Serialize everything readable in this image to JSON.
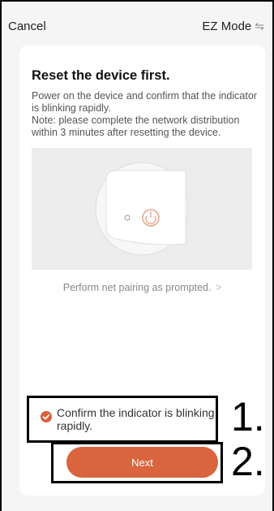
{
  "topbar": {
    "cancel_label": "Cancel",
    "mode_label": "EZ Mode",
    "mode_icon": "swap-icon"
  },
  "card": {
    "title": "Reset the device first.",
    "description_line1": "Power on the device and confirm that the indicator is blinking rapidly.",
    "description_line2": "Note: please complete the network distribution within 3 minutes after resetting the device.",
    "pairing_link": "Perform net pairing as prompted.",
    "pairing_chevron": ">",
    "confirm_label": "Confirm the indicator is blinking rapidly.",
    "confirm_checked": true,
    "next_label": "Next"
  },
  "annotations": {
    "marker1": "1.",
    "marker2": "2."
  },
  "colors": {
    "accent": "#d9643e",
    "background": "#f5f5f5"
  }
}
